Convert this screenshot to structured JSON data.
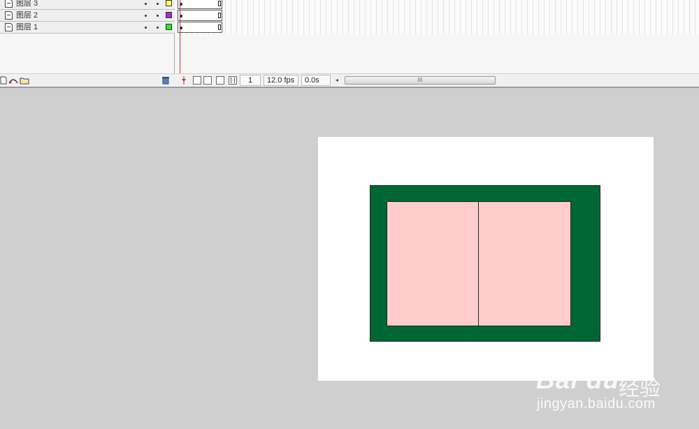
{
  "layers": [
    {
      "name": "图层 3",
      "color": "#ffff66"
    },
    {
      "name": "图层 2",
      "color": "#9933cc"
    },
    {
      "name": "图层 1",
      "color": "#33dd33"
    }
  ],
  "status": {
    "frame": "1",
    "fps": "12.0 fps",
    "time": "0.0s"
  },
  "scrollbar": {
    "arrow": "◂",
    "grip": "III"
  },
  "colors": {
    "stage_bg": "#ffffff",
    "workspace_bg": "#cfcfcf",
    "outer_rect_fill": "#006633",
    "inner_rect_fill": "#ffcccc",
    "playhead": "#c0392b"
  },
  "watermark": {
    "brand": "Bai du",
    "brand_cn": "经验",
    "url": "jingyan.baidu.com"
  },
  "icons": {
    "layer": "layer-icon",
    "add_layer": "add-layer-icon",
    "add_guide": "add-guide-layer-icon",
    "add_folder": "add-folder-icon",
    "delete": "trash-icon",
    "center_frame": "center-frame-icon",
    "onion_skin": "onion-skin-icon",
    "onion_outline": "onion-skin-outline-icon",
    "edit_multiple": "edit-multiple-frames-icon",
    "markers": "onion-markers-icon"
  }
}
